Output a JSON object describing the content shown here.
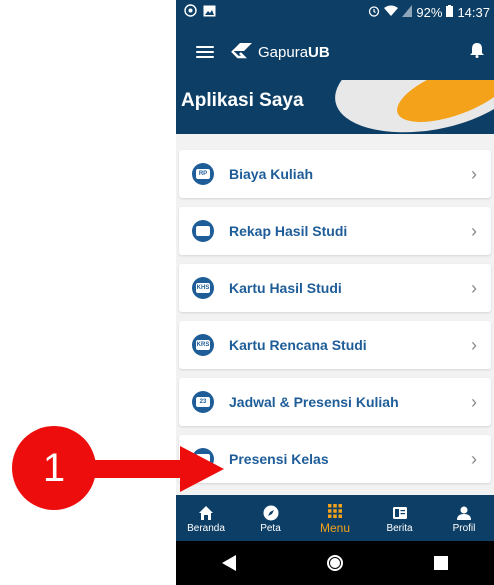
{
  "status_bar": {
    "battery": "92%",
    "time": "14:37"
  },
  "app_bar": {
    "logo_prefix": "Gapura",
    "logo_suffix": "UB"
  },
  "banner": {
    "title": "Aplikasi Saya"
  },
  "menu_items": [
    {
      "label": "Biaya Kuliah",
      "icon": "money-icon",
      "icon_text": "RP"
    },
    {
      "label": "Rekap Hasil Studi",
      "icon": "report-icon",
      "icon_text": ""
    },
    {
      "label": "Kartu Hasil Studi",
      "icon": "khs-card-icon",
      "icon_text": "KHS"
    },
    {
      "label": "Kartu Rencana Studi",
      "icon": "krs-card-icon",
      "icon_text": "KRS"
    },
    {
      "label": "Jadwal & Presensi Kuliah",
      "icon": "calendar-icon",
      "icon_text": "23"
    },
    {
      "label": "Presensi Kelas",
      "icon": "calendar-icon",
      "icon_text": ""
    }
  ],
  "bottom_nav": [
    {
      "label": "Beranda",
      "icon": "home-icon"
    },
    {
      "label": "Peta",
      "icon": "compass-icon"
    },
    {
      "label": "Menu",
      "icon": "grid-icon",
      "active": true
    },
    {
      "label": "Berita",
      "icon": "news-icon"
    },
    {
      "label": "Profil",
      "icon": "profile-icon"
    }
  ],
  "annotation": {
    "step_number": "1"
  },
  "colors": {
    "primary": "#0d3f66",
    "accent": "#f3a21a",
    "item_text": "#1f5d99",
    "marker": "#ee0d0d"
  }
}
